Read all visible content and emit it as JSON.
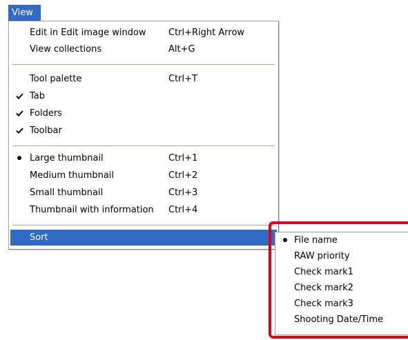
{
  "menubar": {
    "title": "View"
  },
  "menu": {
    "items": [
      {
        "label": "Edit in Edit image window",
        "shortcut": "Ctrl+Right Arrow",
        "mark": ""
      },
      {
        "label": "View collections",
        "shortcut": "Alt+G",
        "mark": ""
      },
      {
        "label": "Tool palette",
        "shortcut": "Ctrl+T",
        "mark": ""
      },
      {
        "label": "Tab",
        "shortcut": "",
        "mark": "check"
      },
      {
        "label": "Folders",
        "shortcut": "",
        "mark": "check"
      },
      {
        "label": "Toolbar",
        "shortcut": "",
        "mark": "check"
      },
      {
        "label": "Large thumbnail",
        "shortcut": "Ctrl+1",
        "mark": "bullet"
      },
      {
        "label": "Medium thumbnail",
        "shortcut": "Ctrl+2",
        "mark": ""
      },
      {
        "label": "Small thumbnail",
        "shortcut": "Ctrl+3",
        "mark": ""
      },
      {
        "label": "Thumbnail with information",
        "shortcut": "Ctrl+4",
        "mark": ""
      },
      {
        "label": "Sort",
        "shortcut": "",
        "mark": "",
        "highlighted": true
      }
    ]
  },
  "submenu": {
    "items": [
      {
        "label": "File name",
        "mark": "bullet"
      },
      {
        "label": "RAW priority",
        "mark": ""
      },
      {
        "label": "Check mark1",
        "mark": ""
      },
      {
        "label": "Check mark2",
        "mark": ""
      },
      {
        "label": "Check mark3",
        "mark": ""
      },
      {
        "label": "Shooting Date/Time",
        "mark": ""
      }
    ]
  },
  "colors": {
    "highlight": "#316ac5",
    "highlight_text": "#ffffff",
    "callout_outline": "#e0001a",
    "separator": "#aca899"
  },
  "icons": {
    "check": "check-icon",
    "bullet": "radio-bullet-icon"
  }
}
